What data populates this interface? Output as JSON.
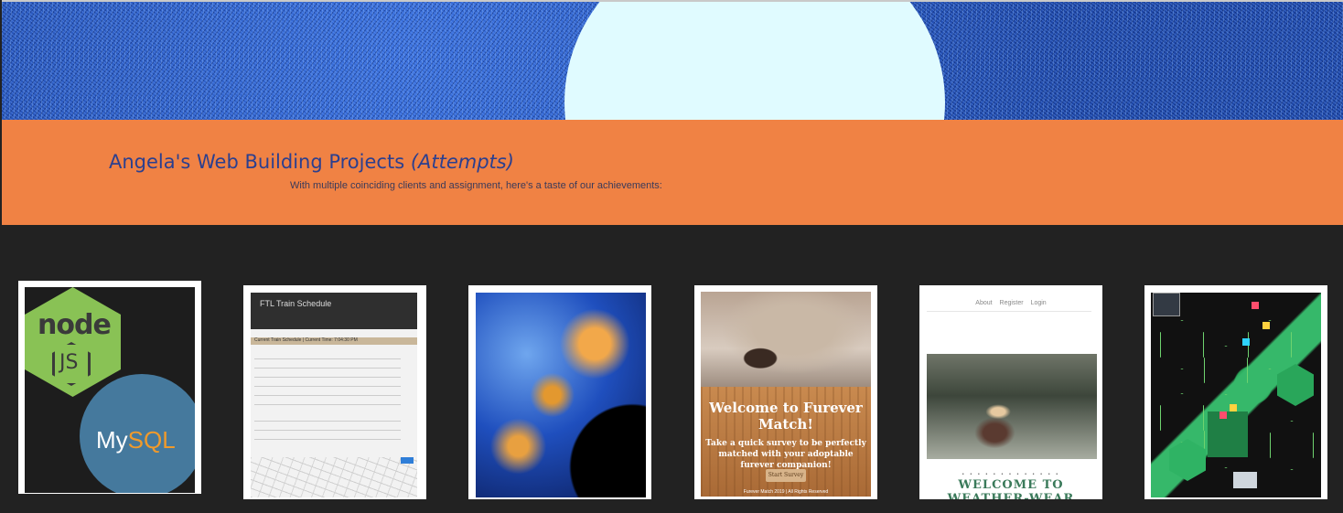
{
  "header": {
    "title_main": "Angela's Web Building Projects",
    "title_italic": "(Attempts)",
    "subtitle": "With multiple coinciding clients and assignment, here's a taste of our achievements:"
  },
  "colors": {
    "banner": "#f08244",
    "title": "#2b3f8f",
    "page_bg": "#222222",
    "hero_bg": "#2353b8",
    "hero_moon": "#e0fbff"
  },
  "projects": [
    {
      "name": "node-mysql",
      "logo_texts": {
        "node": "node",
        "js": "JS",
        "mysql_a": "My",
        "mysql_b": "SQL"
      }
    },
    {
      "name": "train-schedule",
      "title": "FTL Train Schedule",
      "bar_label": "Current Train Schedule | Current Time: 7:04:30 PM"
    },
    {
      "name": "fractal"
    },
    {
      "name": "furever-match",
      "title": "Welcome to Furever Match!",
      "subtitle": "Take a quick survey to be perfectly matched with your adoptable furever companion!",
      "button": "Start Survey",
      "footer": "Furever Match 2019 | All Rights Reserved"
    },
    {
      "name": "weather-wear",
      "nav": [
        "About",
        "Register",
        "Login"
      ],
      "dots": "• • • • • • • • • • • • •",
      "title": "WELCOME TO WEATHER-WEAR"
    },
    {
      "name": "isometric-art"
    }
  ]
}
